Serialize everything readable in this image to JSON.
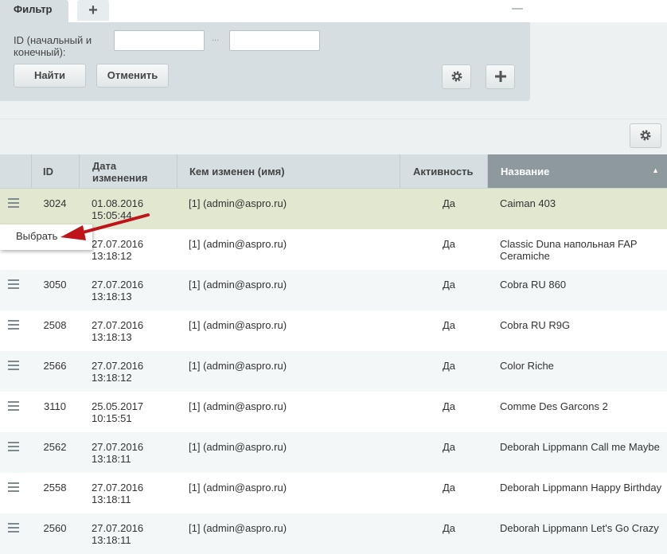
{
  "filter": {
    "tab_label": "Фильтр",
    "add_tab_label": "+",
    "id_label": "ID (начальный и конечный):",
    "id_from_value": "",
    "id_to_value": "",
    "range_separator": "...",
    "find_label": "Найти",
    "cancel_label": "Отменить",
    "settings_icon": "gear-icon",
    "add_icon": "plus-icon"
  },
  "grid": {
    "settings_icon": "gear-icon",
    "columns": {
      "id": "ID",
      "date": "Дата изменения",
      "modified_by": "Кем изменен (имя)",
      "active": "Активность",
      "name": "Название"
    },
    "sorted_column": "name",
    "sort_direction": "asc",
    "rows": [
      {
        "id": "3024",
        "date": "01.08.2016",
        "time": "15:05:44",
        "by": "[1] (admin@aspro.ru)",
        "active": "Да",
        "name": "Caiman 403"
      },
      {
        "id": "",
        "date": "27.07.2016",
        "time": "13:18:12",
        "by": "[1] (admin@aspro.ru)",
        "active": "Да",
        "name": "Classic Duna напольная FAP Ceramiche"
      },
      {
        "id": "3050",
        "date": "27.07.2016",
        "time": "13:18:13",
        "by": "[1] (admin@aspro.ru)",
        "active": "Да",
        "name": "Cobra RU 860"
      },
      {
        "id": "2508",
        "date": "27.07.2016",
        "time": "13:18:13",
        "by": "[1] (admin@aspro.ru)",
        "active": "Да",
        "name": "Cobra RU R9G"
      },
      {
        "id": "2566",
        "date": "27.07.2016",
        "time": "13:18:12",
        "by": "[1] (admin@aspro.ru)",
        "active": "Да",
        "name": "Color Riche"
      },
      {
        "id": "3110",
        "date": "25.05.2017",
        "time": "10:15:51",
        "by": "[1] (admin@aspro.ru)",
        "active": "Да",
        "name": "Comme Des Garcons 2"
      },
      {
        "id": "2562",
        "date": "27.07.2016",
        "time": "13:18:11",
        "by": "[1] (admin@aspro.ru)",
        "active": "Да",
        "name": "Deborah Lippmann Call me Maybe"
      },
      {
        "id": "2558",
        "date": "27.07.2016",
        "time": "13:18:11",
        "by": "[1] (admin@aspro.ru)",
        "active": "Да",
        "name": "Deborah Lippmann Happy Birthday"
      },
      {
        "id": "2560",
        "date": "27.07.2016",
        "time": "13:18:11",
        "by": "[1] (admin@aspro.ru)",
        "active": "Да",
        "name": "Deborah Lippmann Let's Go Crazy"
      }
    ]
  },
  "context_menu": {
    "select_label": "Выбрать"
  },
  "colors": {
    "panel": "#d6dee1",
    "highlight_row": "#e2e7d0",
    "sorted_header": "#8e999d",
    "annotation_arrow": "#c0141b"
  }
}
